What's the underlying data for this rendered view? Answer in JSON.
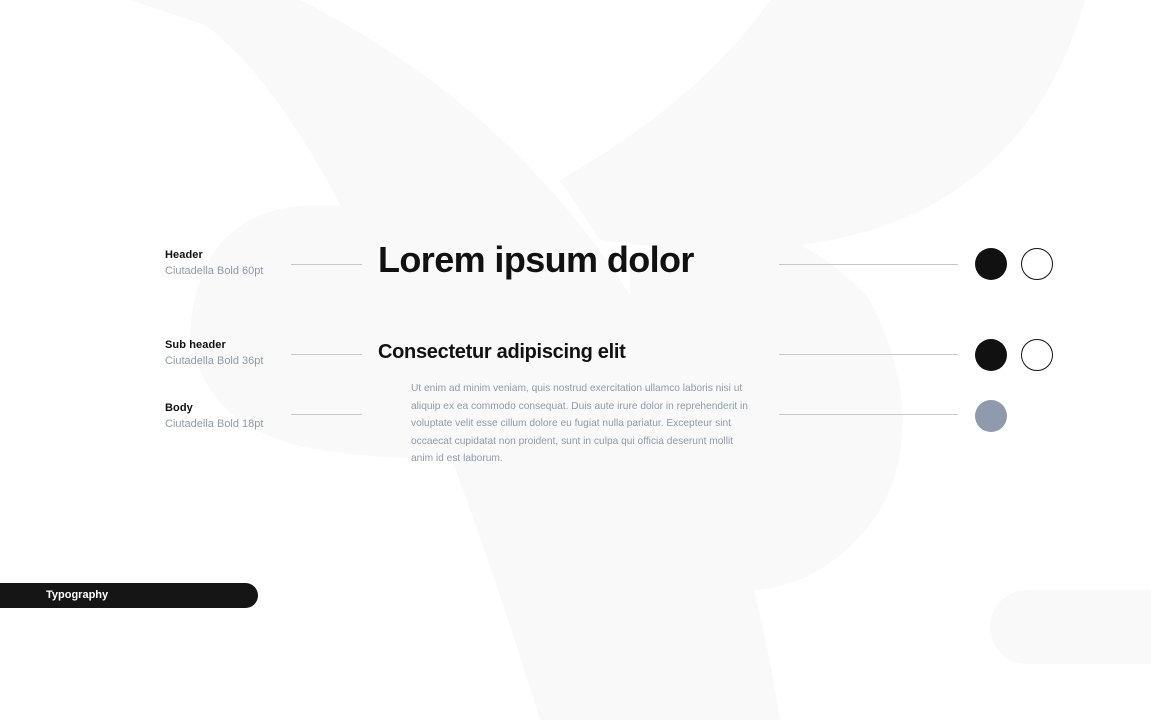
{
  "rows": {
    "header": {
      "name": "Header",
      "detail": "Ciutadella Bold 60pt",
      "sample": "Lorem ipsum dolor",
      "swatches": [
        {
          "icon": "black-swatch-icon",
          "fill": "#111111",
          "style": "filled"
        },
        {
          "icon": "white-swatch-icon",
          "fill": "#ffffff",
          "style": "outline"
        }
      ]
    },
    "subheader": {
      "name": "Sub header",
      "detail": "Ciutadella Bold 36pt",
      "sample": "Consectetur adipiscing elit",
      "swatches": [
        {
          "icon": "black-swatch-icon",
          "fill": "#111111",
          "style": "filled"
        },
        {
          "icon": "white-swatch-icon",
          "fill": "#ffffff",
          "style": "outline"
        }
      ]
    },
    "body": {
      "name": "Body",
      "detail": "Ciutadella Bold 18pt",
      "sample": "Ut enim ad minim veniam, quis nostrud exercitation ullamco laboris nisi ut aliquip ex ea commodo consequat. Duis aute irure dolor in reprehenderit in voluptate velit esse cillum dolore eu fugiat nulla pariatur. Excepteur sint occaecat cupidatat non proident, sunt in culpa qui officia deserunt mollit anim id est laborum.",
      "swatches": [
        {
          "icon": "gray-blue-swatch-icon",
          "fill": "#8f9aac",
          "style": "filled"
        }
      ]
    }
  },
  "tag": {
    "label": "Typography"
  },
  "colors": {
    "primary_text": "#111111",
    "secondary_text": "#8f9aac",
    "rule": "#c8c8c8",
    "tag_background": "#151515",
    "background_shape": "#f9f9f9"
  }
}
